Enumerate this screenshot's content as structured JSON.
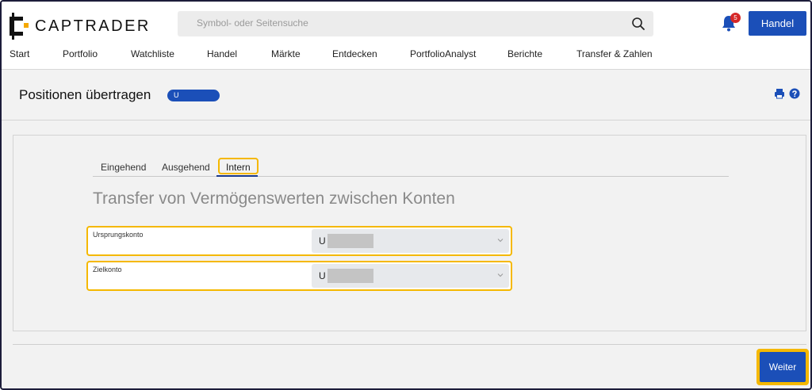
{
  "header": {
    "logo_text": "CAPTRADER",
    "search_placeholder": "Symbol- oder Seitensuche",
    "notification_count": "5",
    "trade_button": "Handel"
  },
  "nav": {
    "items": [
      "Start",
      "Portfolio",
      "Watchliste",
      "Handel",
      "Märkte",
      "Entdecken",
      "PortfolioAnalyst",
      "Berichte",
      "Transfer & Zahlen"
    ]
  },
  "page": {
    "title": "Positionen übertragen",
    "account_pill": "U"
  },
  "tabs": {
    "incoming": "Eingehend",
    "outgoing": "Ausgehend",
    "internal": "Intern",
    "active": "Intern"
  },
  "form": {
    "heading": "Transfer von Vermögenswerten zwischen Konten",
    "source_label": "Ursprungskonto",
    "source_value": "U",
    "target_label": "Zielkonto",
    "target_value": "U"
  },
  "actions": {
    "next_button": "Weiter"
  },
  "colors": {
    "accent_blue": "#1b4fb8",
    "highlight_yellow": "#f5b800",
    "logo_dot": "#f5a800",
    "badge_red": "#d62828"
  }
}
